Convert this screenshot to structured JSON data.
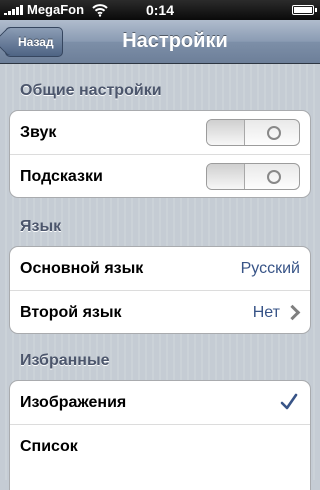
{
  "status_bar": {
    "carrier": "MegaFon",
    "time": "0:14",
    "signal_bars": 5,
    "battery_level": 1.0
  },
  "nav": {
    "back_label": "Назад",
    "title": "Настройки"
  },
  "sections": {
    "general": {
      "header": "Общие настройки",
      "rows": [
        {
          "label": "Звук",
          "toggle_on": false
        },
        {
          "label": "Подсказки",
          "toggle_on": false
        }
      ]
    },
    "language": {
      "header": "Язык",
      "rows": [
        {
          "label": "Основной язык",
          "value": "Русский"
        },
        {
          "label": "Второй язык",
          "value": "Нет"
        }
      ]
    },
    "favorites": {
      "header": "Избранные",
      "rows": [
        {
          "label": "Изображения",
          "checked": true
        },
        {
          "label": "Список",
          "checked": false
        }
      ]
    }
  },
  "colors": {
    "accent_text": "#385487",
    "section_header": "#4c566c",
    "nav_bar": "#8a9bb3"
  },
  "icons": {
    "wifi": "wifi-icon",
    "battery": "battery-icon",
    "chevron": "chevron-right-icon",
    "check": "checkmark-icon"
  }
}
